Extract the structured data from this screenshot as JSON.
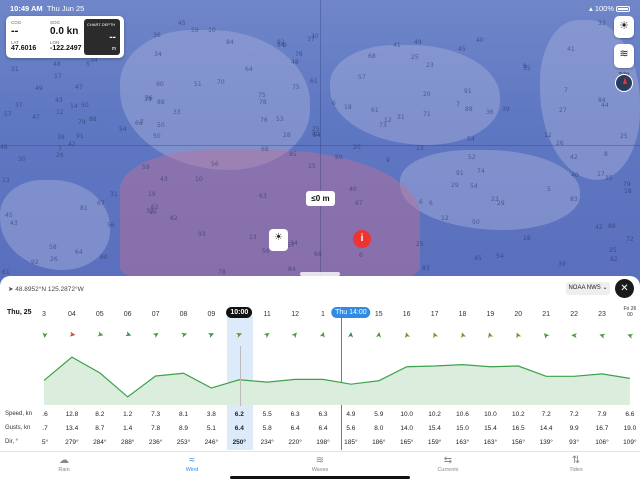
{
  "status": {
    "time": "10:49 AM",
    "date": "Thu Jun 25",
    "battery": "100%"
  },
  "nav": {
    "cog_label": "COG",
    "cog_value": "--",
    "sog_label": "SOG",
    "sog_value": "0.0 kn",
    "lat_label": "LAT",
    "lat_value": "47.6016",
    "lon_label": "LON",
    "lon_value": "-122.2497",
    "depth_title": "CHART DEPTH",
    "depth_value": "--",
    "depth_unit": "m"
  },
  "map": {
    "tides_label": "Tides",
    "depth_marker": "≤0 m",
    "info_icon": "i"
  },
  "panel": {
    "coordinates": "48.8952°N  125.2872°W",
    "source": "NOAA NWS",
    "day": "Thu, 25",
    "hours": [
      "3",
      "04",
      "05",
      "06",
      "07",
      "08",
      "09",
      "10:00",
      "11",
      "12",
      "1",
      "Thu 14:00",
      "15",
      "16",
      "17",
      "18",
      "19",
      "20",
      "21",
      "22",
      "23",
      "Fri 26\n00"
    ],
    "selected_index": 7,
    "now_index": 11
  },
  "chart_data": {
    "type": "line",
    "title": "",
    "series": [
      {
        "name": "Speed, kn",
        "values": [
          6,
          12.8,
          8.2,
          1.2,
          7.3,
          8.1,
          3.8,
          6.2,
          5.5,
          6.3,
          6.3,
          4.9,
          5.9,
          10.0,
          10.2,
          10.6,
          10.0,
          10.2,
          7.2,
          7.2,
          7.9,
          6.6
        ]
      }
    ],
    "x": [
      "3",
      "04",
      "05",
      "06",
      "07",
      "08",
      "09",
      "10:00",
      "11",
      "12",
      "1",
      "14:00",
      "15",
      "16",
      "17",
      "18",
      "19",
      "20",
      "21",
      "22",
      "23",
      "00"
    ]
  },
  "rows": {
    "speed": {
      "label": "Speed, kn",
      "values": [
        ".6",
        "12.8",
        "8.2",
        "1.2",
        "7.3",
        "8.1",
        "3.8",
        "6.2",
        "5.5",
        "6.3",
        "6.3",
        "4.9",
        "5.9",
        "10.0",
        "10.2",
        "10.6",
        "10.0",
        "10.2",
        "7.2",
        "7.2",
        "7.9",
        "6.6"
      ]
    },
    "gusts": {
      "label": "Gusts, kn",
      "values": [
        ".7",
        "13.4",
        "8.7",
        "1.4",
        "7.8",
        "8.9",
        "5.1",
        "6.4",
        "5.8",
        "6.4",
        "6.4",
        "5.6",
        "8.0",
        "14.0",
        "15.4",
        "15.0",
        "15.4",
        "16.5",
        "14.4",
        "9.9",
        "16.7",
        "19.0"
      ]
    },
    "dir": {
      "label": "Dir, °",
      "values": [
        "5°",
        "279°",
        "284°",
        "288°",
        "236°",
        "253°",
        "246°",
        "250°",
        "234°",
        "220°",
        "198°",
        "185°",
        "186°",
        "165°",
        "159°",
        "163°",
        "163°",
        "156°",
        "139°",
        "93°",
        "106°",
        "109°"
      ]
    }
  },
  "wind_dirs": [
    5,
    279,
    284,
    288,
    236,
    253,
    246,
    250,
    234,
    220,
    198,
    185,
    186,
    165,
    159,
    163,
    163,
    156,
    139,
    93,
    106,
    109
  ],
  "tabs": [
    {
      "label": "Rain",
      "icon": "cloud-rain-icon"
    },
    {
      "label": "Wind",
      "icon": "wind-icon",
      "active": true
    },
    {
      "label": "Waves",
      "icon": "waves-icon"
    },
    {
      "label": "Currents",
      "icon": "currents-icon"
    },
    {
      "label": "Tides",
      "icon": "tides-icon"
    }
  ],
  "colors": {
    "accent": "#2f8be6",
    "line": "#3da24a",
    "area": "#dbeedd",
    "pin": "#e33333"
  }
}
